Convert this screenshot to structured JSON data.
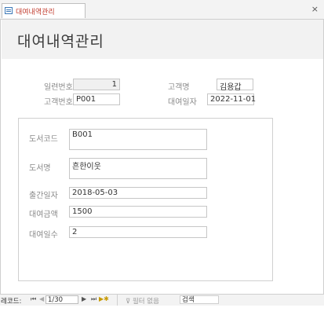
{
  "tab": {
    "label": "대여내역관리",
    "close": "×"
  },
  "form": {
    "title": "대여내역관리",
    "fields": {
      "serial_label": "일련번호",
      "serial_value": "1",
      "customer_name_label": "고객명",
      "customer_name_value": "김용갑",
      "customer_no_label": "고객번호",
      "customer_no_value": "P001",
      "rent_date_label": "대여일자",
      "rent_date_value": "2022-11-01",
      "book_code_label": "도서코드",
      "book_code_value": "B001",
      "book_name_label": "도서명",
      "book_name_value": "흔한이웃",
      "pub_date_label": "출간일자",
      "pub_date_value": "2018-05-03",
      "rent_price_label": "대여금액",
      "rent_price_value": "1500",
      "rent_days_label": "대여일수",
      "rent_days_value": "2"
    }
  },
  "navigation": {
    "record_label": "레코드:",
    "first": "⏮",
    "prev": "◀",
    "position": "1/30",
    "next": "▶",
    "last": "⏭",
    "new": "▶✱",
    "filter_label": "필터 없음",
    "search_label": "검색"
  }
}
